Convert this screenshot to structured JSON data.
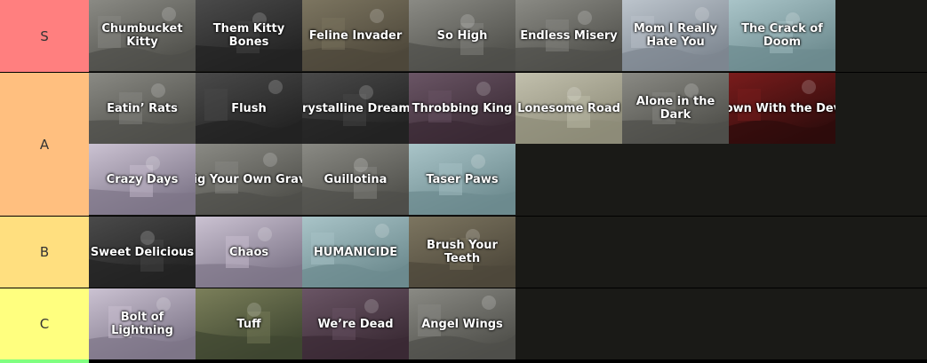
{
  "tiers": [
    {
      "label": "S",
      "color": "#ff7f7f",
      "items": [
        {
          "title": "Chumbucket Kitty",
          "theme": "gray"
        },
        {
          "title": "Them Kitty Bones",
          "theme": "dark"
        },
        {
          "title": "Feline Invader",
          "theme": "olive"
        },
        {
          "title": "So High",
          "theme": "gray"
        },
        {
          "title": "Endless Misery",
          "theme": "gray"
        },
        {
          "title": "Mom I Really Hate You",
          "theme": "pale"
        },
        {
          "title": "The Crack of Doom",
          "theme": "teal"
        }
      ]
    },
    {
      "label": "A",
      "color": "#ffbf7f",
      "items": [
        {
          "title": "Eatin’ Rats",
          "theme": "gray"
        },
        {
          "title": "Flush",
          "theme": "dark"
        },
        {
          "title": "Crystalline Dreams",
          "theme": "dark"
        },
        {
          "title": "Throbbing King",
          "theme": "purple"
        },
        {
          "title": "Lonesome Road",
          "theme": "beige"
        },
        {
          "title": "Alone in the Dark",
          "theme": "gray"
        },
        {
          "title": "Down With the Devil",
          "theme": "red"
        },
        {
          "title": "Crazy Days",
          "theme": "lilac"
        },
        {
          "title": "Dig Your Own Grave",
          "theme": "gray"
        },
        {
          "title": "Guillotina",
          "theme": "gray"
        },
        {
          "title": "Taser Paws",
          "theme": "teal"
        }
      ]
    },
    {
      "label": "B",
      "color": "#ffdf7f",
      "items": [
        {
          "title": "Sweet Delicious",
          "theme": "dark"
        },
        {
          "title": "Chaos",
          "theme": "lilac"
        },
        {
          "title": "HUMANICIDE",
          "theme": "teal"
        },
        {
          "title": "Brush Your Teeth",
          "theme": "olive"
        }
      ]
    },
    {
      "label": "C",
      "color": "#ffff7f",
      "items": [
        {
          "title": "Bolt of Lightning",
          "theme": "lilac"
        },
        {
          "title": "Tuff",
          "theme": "green"
        },
        {
          "title": "We’re Dead",
          "theme": "purple"
        },
        {
          "title": "Angel Wings",
          "theme": "gray"
        }
      ]
    }
  ],
  "next_tier_color": "#7fff7f",
  "themes": {
    "gray": [
      "#8a8a84",
      "#4f4f4a"
    ],
    "dark": [
      "#4a4a4a",
      "#222222"
    ],
    "olive": [
      "#7c7560",
      "#4d473a"
    ],
    "pale": [
      "#bcc4cc",
      "#7d8690"
    ],
    "teal": [
      "#a9c4c8",
      "#6c8a8e"
    ],
    "purple": [
      "#6a5565",
      "#3a2a34"
    ],
    "beige": [
      "#c2c0ad",
      "#8d8b78"
    ],
    "red": [
      "#7a1c1c",
      "#2e0c0c"
    ],
    "lilac": [
      "#cbc2d2",
      "#7d7588"
    ],
    "green": [
      "#7b7f5a",
      "#3e4630"
    ]
  }
}
